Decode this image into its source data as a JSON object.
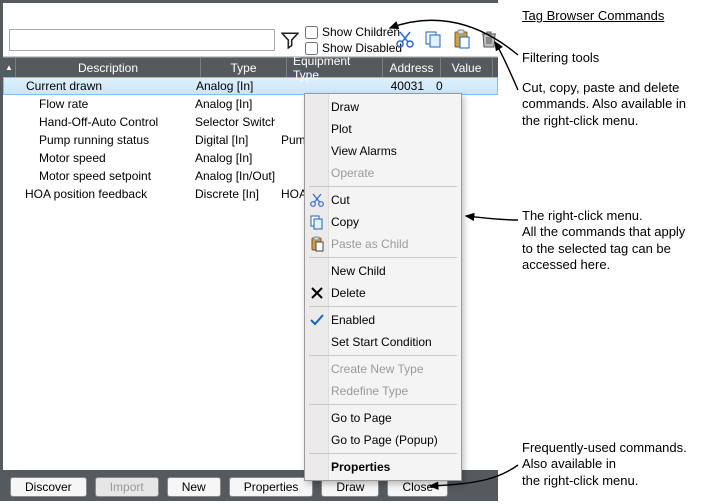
{
  "checkboxes": {
    "show_children": "Show Children",
    "show_disabled": "Show Disabled"
  },
  "columns": {
    "description": "Description",
    "type": "Type",
    "equipment": "Equipment Type",
    "address": "Address",
    "value": "Value"
  },
  "rows": [
    {
      "desc": "Current drawn",
      "type": "Analog [In]",
      "eq": "",
      "addr": "40031",
      "val": "0",
      "selected": true,
      "indent": 1
    },
    {
      "desc": "Flow rate",
      "type": "Analog [In]",
      "eq": "",
      "addr": "",
      "val": "",
      "indent": 2
    },
    {
      "desc": "Hand-Off-Auto Control",
      "type": "Selector Switch",
      "eq": "",
      "addr": "",
      "val": "",
      "indent": 2
    },
    {
      "desc": "Pump running status",
      "type": "Digital [In]",
      "eq": "Pump",
      "addr": "",
      "val": "",
      "indent": 2
    },
    {
      "desc": "Motor speed",
      "type": "Analog [In]",
      "eq": "",
      "addr": "",
      "val": "",
      "indent": 2
    },
    {
      "desc": "Motor speed setpoint",
      "type": "Analog [In/Out]",
      "eq": "",
      "addr": "",
      "val": "",
      "indent": 2
    },
    {
      "desc": "HOA position feedback",
      "type": "Discrete [In]",
      "eq": "HOA",
      "addr": "",
      "val": "",
      "indent": 1
    }
  ],
  "context_menu": [
    {
      "label": "Draw"
    },
    {
      "label": "Plot"
    },
    {
      "label": "View Alarms"
    },
    {
      "label": "Operate",
      "disabled": true
    },
    {
      "sep": true
    },
    {
      "label": "Cut",
      "icon": "cut"
    },
    {
      "label": "Copy",
      "icon": "copy"
    },
    {
      "label": "Paste as Child",
      "icon": "paste",
      "disabled": true
    },
    {
      "sep": true
    },
    {
      "label": "New Child"
    },
    {
      "label": "Delete",
      "icon": "delete-x"
    },
    {
      "sep": true
    },
    {
      "label": "Enabled",
      "icon": "check"
    },
    {
      "label": "Set Start Condition"
    },
    {
      "sep": true
    },
    {
      "label": "Create New Type",
      "disabled": true
    },
    {
      "label": "Redefine Type",
      "disabled": true
    },
    {
      "sep": true
    },
    {
      "label": "Go to Page"
    },
    {
      "label": "Go to Page (Popup)"
    },
    {
      "sep": true
    },
    {
      "label": "Properties",
      "bold": true
    }
  ],
  "buttons": {
    "discover": "Discover",
    "import": "Import",
    "new": "New",
    "properties": "Properties",
    "draw": "Draw",
    "close": "Close"
  },
  "annotations": {
    "title": "Tag Browser Commands",
    "filtering": "Filtering tools",
    "cutcopy": "Cut, copy, paste and delete commands. Also available in the right-click menu.",
    "rclick": "The right-click menu.\nAll the commands that apply to the selected tag can be accessed here.",
    "freq": "Frequently-used commands.\nAlso available in\nthe right-click menu."
  }
}
